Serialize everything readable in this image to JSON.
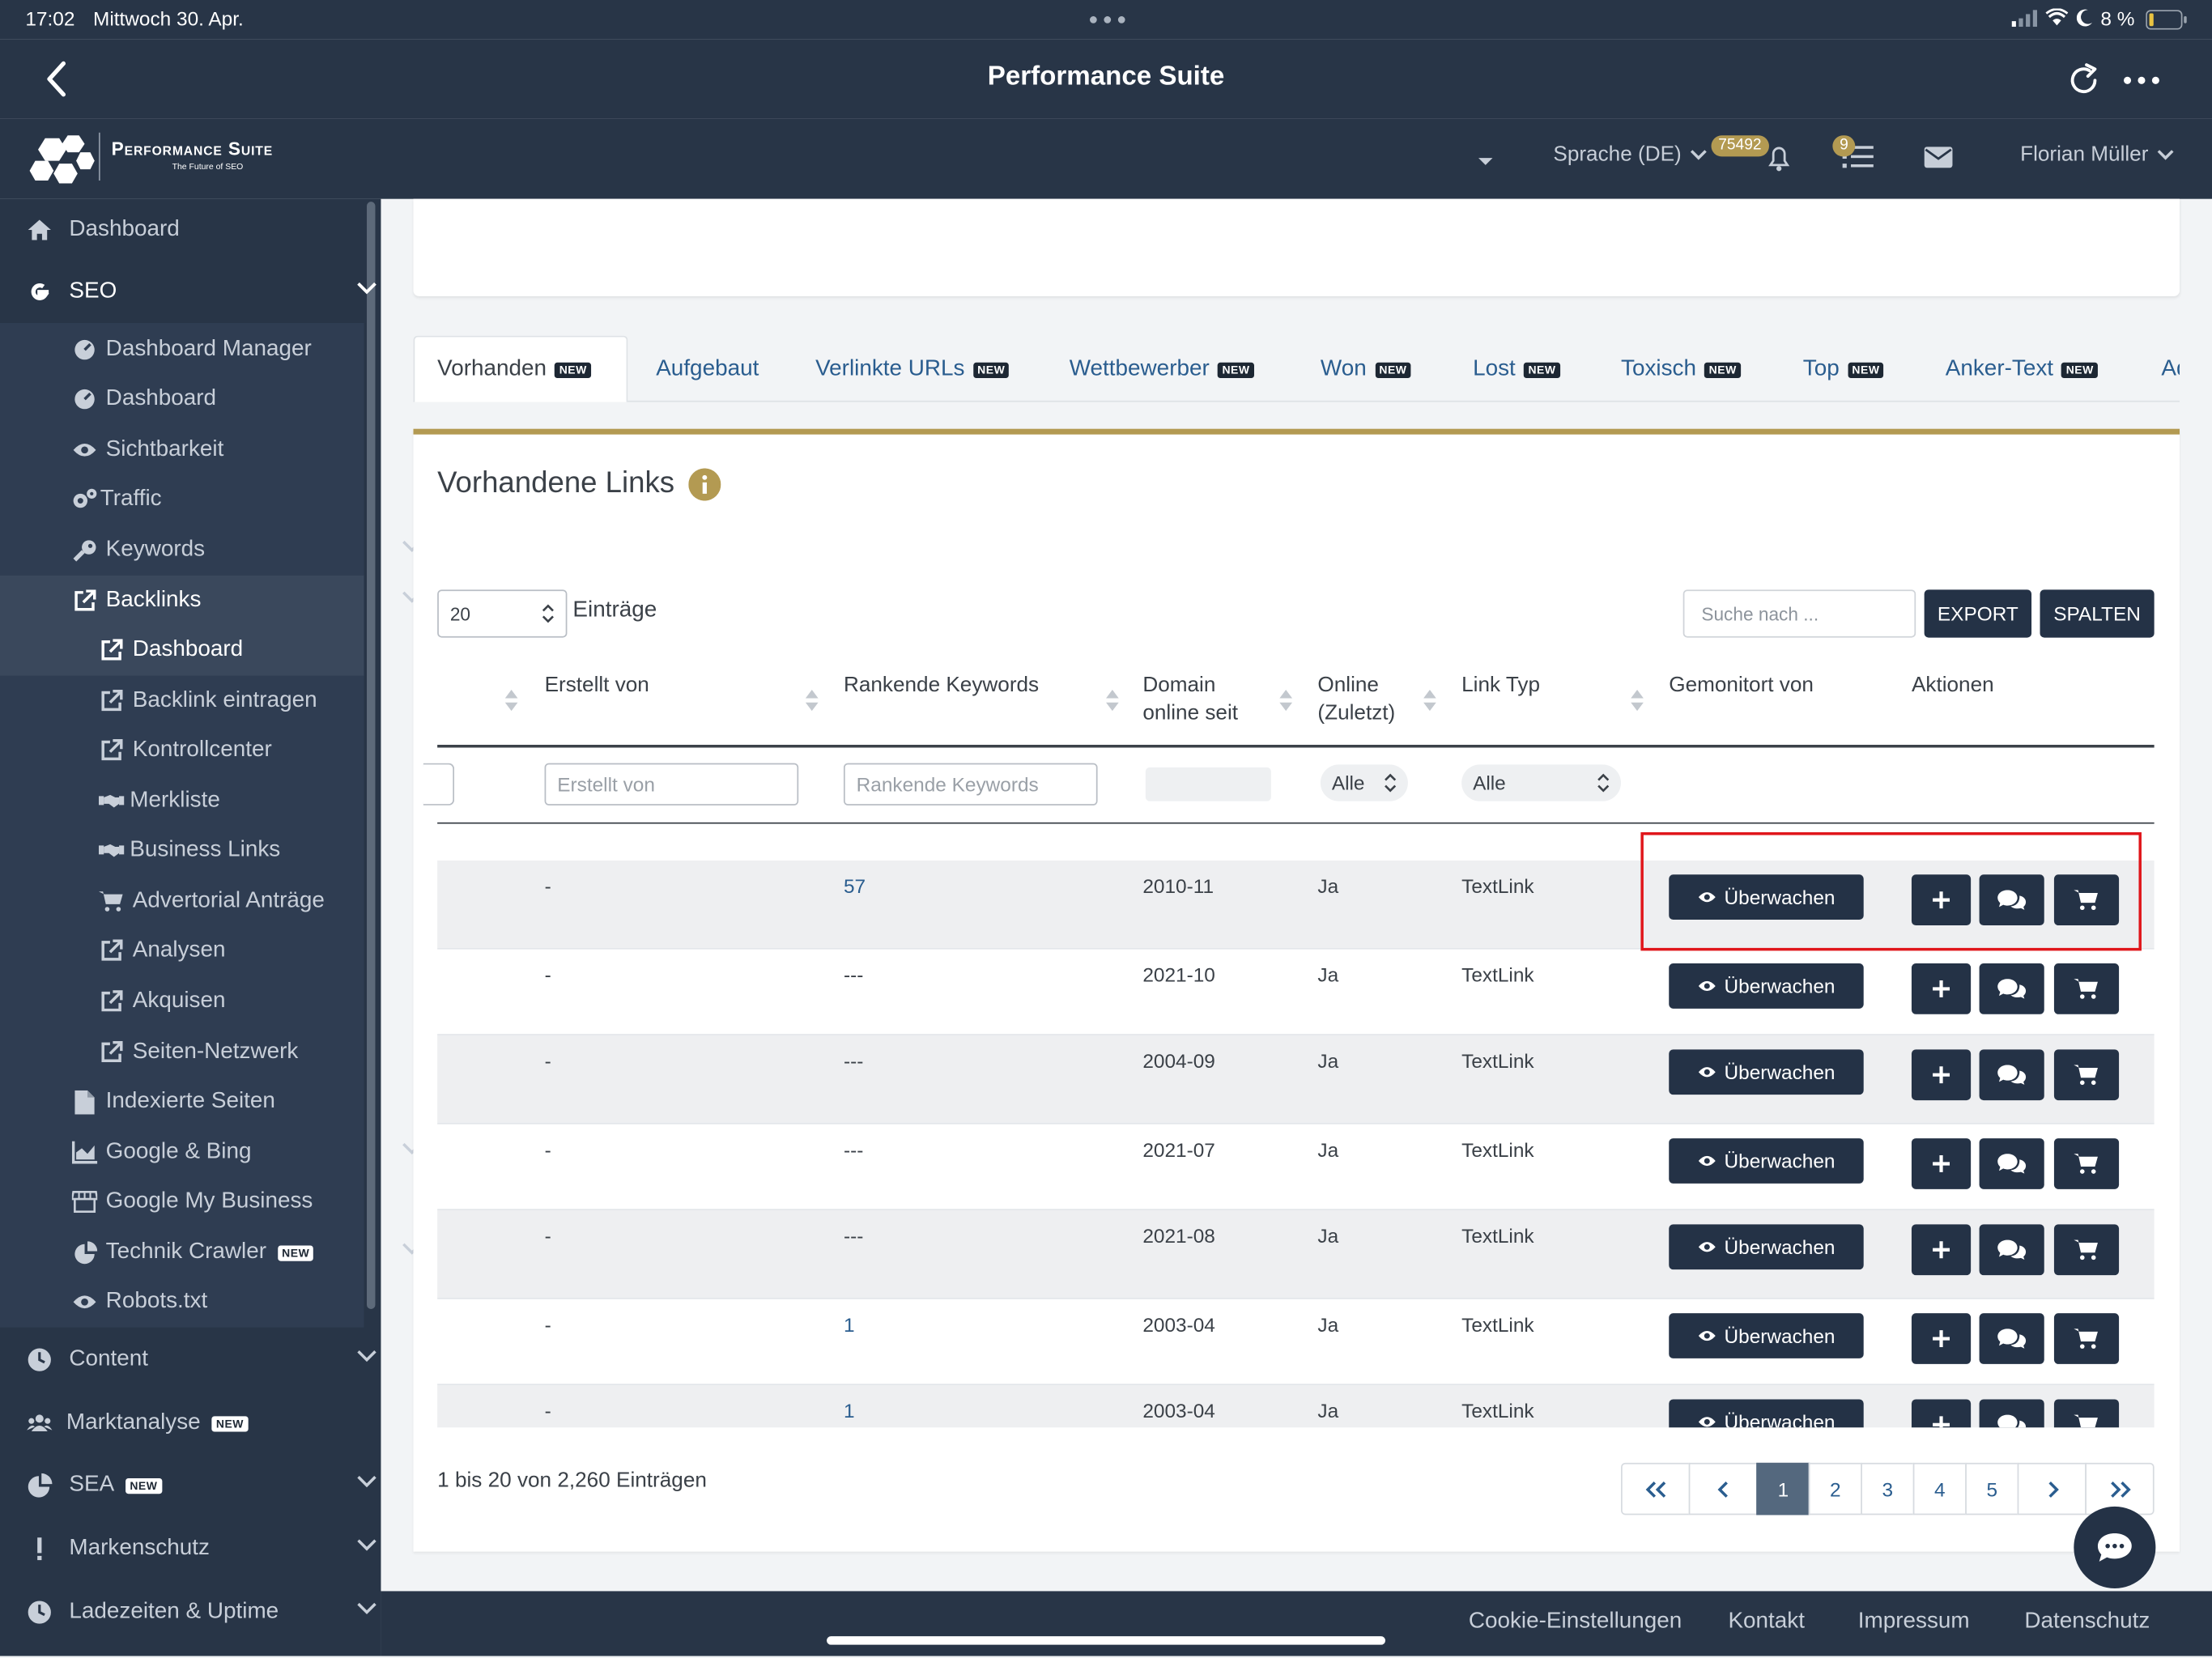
{
  "status_bar": {
    "time": "17:02",
    "date": "Mittwoch 30. Apr.",
    "battery": "8 %"
  },
  "app_bar": {
    "title": "Performance Suite"
  },
  "brand": {
    "name": "Performance Suite",
    "tagline": "The Future of SEO"
  },
  "top_nav": {
    "language": "Sprache (DE)",
    "notification_count": "75492",
    "task_count": "9",
    "user": "Florian Müller"
  },
  "sidebar": {
    "dashboard": "Dashboard",
    "seo": "SEO",
    "seo_items": [
      "Dashboard Manager",
      "Dashboard",
      "Sichtbarkeit",
      "Traffic",
      "Keywords",
      "Backlinks"
    ],
    "backlinks_items": [
      "Dashboard",
      "Backlink eintragen",
      "Kontrollcenter",
      "Merkliste",
      "Business Links",
      "Advertorial Anträge",
      "Analysen",
      "Akquisen",
      "Seiten-Netzwerk"
    ],
    "seo_more": [
      "Indexierte Seiten",
      "Google & Bing",
      "Google My Business",
      "Technik Crawler",
      "Robots.txt"
    ],
    "sections": [
      "Content",
      "Marktanalyse",
      "SEA",
      "Markenschutz",
      "Ladezeiten & Uptime"
    ],
    "new_label": "NEW"
  },
  "tabs": [
    {
      "label": "Vorhanden",
      "new": true
    },
    {
      "label": "Aufgebaut",
      "new": false
    },
    {
      "label": "Verlinkte URLs",
      "new": true
    },
    {
      "label": "Wettbewerber",
      "new": true
    },
    {
      "label": "Won",
      "new": true
    },
    {
      "label": "Lost",
      "new": true
    },
    {
      "label": "Toxisch",
      "new": true
    },
    {
      "label": "Top",
      "new": true
    },
    {
      "label": "Anker-Text",
      "new": true
    },
    {
      "label": "Ad",
      "new": false
    }
  ],
  "panel": {
    "title": "Vorhandene Links",
    "page_size": "20",
    "entries_label": "Einträge",
    "search_placeholder": "Suche nach ...",
    "export_label": "EXPORT",
    "columns_label": "SPALTEN"
  },
  "table": {
    "headers": [
      "Erstellt von",
      "Rankende Keywords",
      "Domain online seit",
      "Online (Zuletzt)",
      "Link Typ",
      "Gemonitort von",
      "Aktionen"
    ],
    "filters": {
      "created_by": "Erstellt von",
      "keywords": "Rankende Keywords",
      "online": "Alle",
      "link_type": "Alle"
    },
    "monitor_label": "Überwachen",
    "rows": [
      {
        "created_by": "-",
        "keywords": "57",
        "since": "2010-11",
        "online": "Ja",
        "type": "TextLink"
      },
      {
        "created_by": "-",
        "keywords": "---",
        "since": "2021-10",
        "online": "Ja",
        "type": "TextLink"
      },
      {
        "created_by": "-",
        "keywords": "---",
        "since": "2004-09",
        "online": "Ja",
        "type": "TextLink"
      },
      {
        "created_by": "-",
        "keywords": "---",
        "since": "2021-07",
        "online": "Ja",
        "type": "TextLink"
      },
      {
        "created_by": "-",
        "keywords": "---",
        "since": "2021-08",
        "online": "Ja",
        "type": "TextLink"
      },
      {
        "created_by": "-",
        "keywords": "1",
        "since": "2003-04",
        "online": "Ja",
        "type": "TextLink"
      },
      {
        "created_by": "-",
        "keywords": "1",
        "since": "2003-04",
        "online": "Ja",
        "type": "TextLink"
      }
    ]
  },
  "pagination": {
    "info": "1 bis 20 von 2,260 Einträgen",
    "pages": [
      "1",
      "2",
      "3",
      "4",
      "5"
    ],
    "current": "1"
  },
  "footer": {
    "links": [
      "Cookie-Einstellungen",
      "Kontakt",
      "Impressum",
      "Datenschutz"
    ]
  },
  "colors": {
    "navy": "#283547",
    "button": "#243246",
    "gold": "#b39a52",
    "link": "#2a5d8f",
    "highlight": "#e0161b"
  }
}
